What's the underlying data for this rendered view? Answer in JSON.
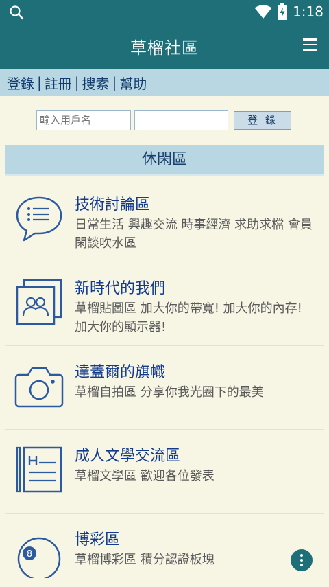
{
  "status_bar": {
    "time": "1:18",
    "icons": [
      "search-icon",
      "wifi-icon",
      "battery-charging-icon"
    ]
  },
  "app_bar": {
    "title": "草榴社區",
    "menu_icon": "menu-icon"
  },
  "links": [
    {
      "label": "登錄"
    },
    {
      "label": "註冊"
    },
    {
      "label": "搜索"
    },
    {
      "label": "幫助"
    }
  ],
  "links_separator": "|",
  "login": {
    "username_placeholder": "輸入用戶名",
    "password_value": "",
    "button_label": "登 錄"
  },
  "section": {
    "title": "休閑區"
  },
  "forums": [
    {
      "title": "技術討論區",
      "description": "日常生活 興趣交流 時事經濟 求助求檔 會員閑談吹水區",
      "icon": "chat-bubble-list-icon"
    },
    {
      "title": "新時代的我們",
      "description": "草榴貼圖區 加大你的帶寬! 加大你的內存! 加大你的顯示器!",
      "icon": "photo-people-icon"
    },
    {
      "title": "達蓋爾的旗幟",
      "description": "草榴自拍區 分享你我光圈下的最美",
      "icon": "camera-icon"
    },
    {
      "title": "成人文學交流區",
      "description": "草榴文學區 歡迎各位發表",
      "icon": "document-h-icon"
    },
    {
      "title": "博彩區",
      "description": "草榴博彩區 積分認證板塊",
      "icon": "billiard-ball-icon"
    }
  ],
  "colors": {
    "primary": "#1e6f78",
    "light_blue": "#b8d7e3",
    "background": "#f7f5e4",
    "link_text": "#123b8e",
    "icon_stroke": "#2c5aa0"
  }
}
